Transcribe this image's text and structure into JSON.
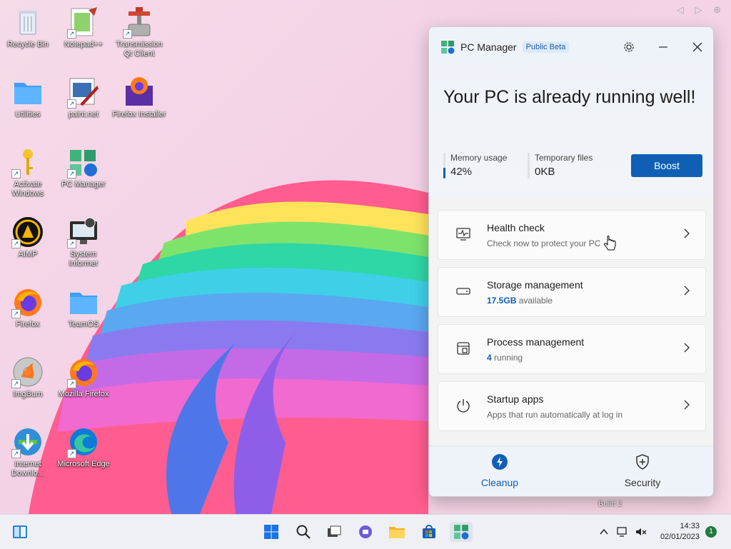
{
  "desktop": {
    "icons": [
      {
        "label": "Recycle Bin",
        "icon": "recycle-bin-icon"
      },
      {
        "label": "Notepad++",
        "icon": "notepad-plus-plus-icon"
      },
      {
        "label": "Transmission Qt Client",
        "icon": "transmission-icon"
      },
      {
        "label": "Utilities",
        "icon": "folder-icon"
      },
      {
        "label": "paint.net",
        "icon": "paintnet-icon"
      },
      {
        "label": "Firefox Installer",
        "icon": "firefox-installer-icon"
      },
      {
        "label": "Activate Windows",
        "icon": "key-icon"
      },
      {
        "label": "PC Manager",
        "icon": "pc-manager-icon"
      },
      {
        "label": "AIMP",
        "icon": "aimp-icon"
      },
      {
        "label": "System Informer",
        "icon": "system-informer-icon"
      },
      {
        "label": "Firefox",
        "icon": "firefox-icon"
      },
      {
        "label": "TeamOS",
        "icon": "folder-icon"
      },
      {
        "label": "ImgBurn",
        "icon": "imgburn-icon"
      },
      {
        "label": "Mozilla Firefox",
        "icon": "firefox-icon"
      },
      {
        "label": "Internet Downlo...",
        "icon": "idm-icon"
      },
      {
        "label": "Microsoft Edge",
        "icon": "edge-icon"
      }
    ],
    "build_text": "Build 2"
  },
  "pc_manager": {
    "title": "PC Manager",
    "badge": "Public Beta",
    "headline": "Your PC is already running well!",
    "memory": {
      "label": "Memory usage",
      "value": "42%",
      "percent": 42
    },
    "temp_files": {
      "label": "Temporary files",
      "value": "0KB"
    },
    "boost_label": "Boost",
    "cards": [
      {
        "title": "Health check",
        "subtitle": "Check now to protect your PC",
        "icon": "health-monitor-icon"
      },
      {
        "title": "Storage management",
        "highlight": "17.5GB",
        "subtitle": "available",
        "icon": "storage-drive-icon"
      },
      {
        "title": "Process management",
        "highlight": "4",
        "subtitle": "running",
        "icon": "process-icon"
      },
      {
        "title": "Startup apps",
        "subtitle": "Apps that run automatically at log in",
        "icon": "power-icon"
      }
    ],
    "nav": [
      {
        "label": "Cleanup",
        "icon": "lightning-icon",
        "active": true
      },
      {
        "label": "Security",
        "icon": "shield-icon",
        "active": false
      }
    ],
    "accent": "#0f5fb5"
  },
  "taskbar": {
    "time": "14:33",
    "date": "02/01/2023",
    "notification_count": "1"
  }
}
